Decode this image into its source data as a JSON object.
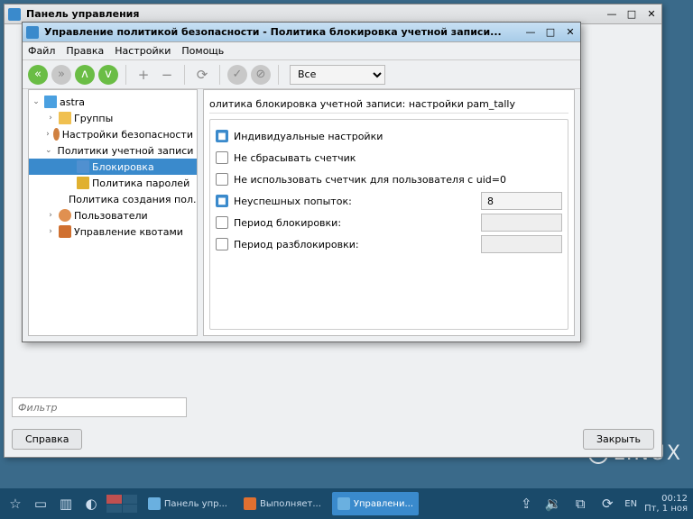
{
  "parent": {
    "title": "Панель управления",
    "filter_placeholder": "Фильтр",
    "help_btn": "Справка",
    "close_btn": "Закрыть"
  },
  "child": {
    "title": "Управление политикой безопасности - Политика блокировка учетной записи...",
    "menu": {
      "file": "Файл",
      "edit": "Правка",
      "settings": "Настройки",
      "help": "Помощь"
    },
    "combo_value": "Все",
    "tree": {
      "root": "astra",
      "groups": "Группы",
      "security": "Настройки безопасности",
      "acct_policies": "Политики учетной записи",
      "lockout": "Блокировка",
      "pwd_policy": "Политика паролей",
      "create_policy": "Политика создания пол...",
      "users": "Пользователи",
      "quotas": "Управление квотами"
    },
    "detail_header": "олитика блокировка учетной записи: настройки pam_tally",
    "form": {
      "individual": "Индивидуальные настройки",
      "noreset": "Не сбрасывать счетчик",
      "uid0": "Не использовать счетчик для пользователя с uid=0",
      "failed_label": "Неуспешных попыток:",
      "failed_value": "8",
      "lock_period": "Период блокировки:",
      "unlock_period": "Период разблокировки:"
    }
  },
  "watermark": "LINUX",
  "taskbar": {
    "task1": "Панель упр...",
    "task2": "Выполняет...",
    "task3": "Управлени...",
    "lang": "EN",
    "time": "00:12",
    "date": "Пт, 1 ноя"
  }
}
